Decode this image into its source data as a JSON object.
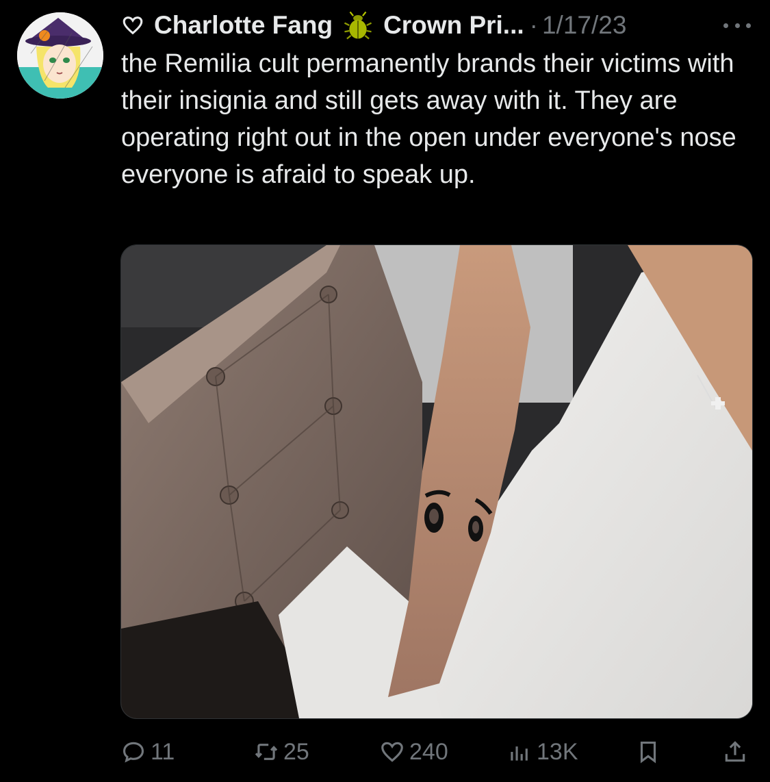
{
  "author": {
    "display_name": "Charlotte Fang",
    "handle": "Crown Pri...",
    "separator": "·",
    "date": "1/17/23",
    "heart_icon": "heart-outline-icon",
    "badge_icon": "beetle-icon"
  },
  "tweet": {
    "text": "the Remilia cult permanently brands their victims with their insignia and still gets away with it. They are operating right out in the open under everyone's nose everyone is afraid to speak up."
  },
  "media": {
    "kind": "photo"
  },
  "actions": {
    "replies": "11",
    "retweets": "25",
    "likes": "240",
    "views": "13K"
  },
  "colors": {
    "background": "#000000",
    "text": "#e7e9ea",
    "muted": "#71767b"
  }
}
